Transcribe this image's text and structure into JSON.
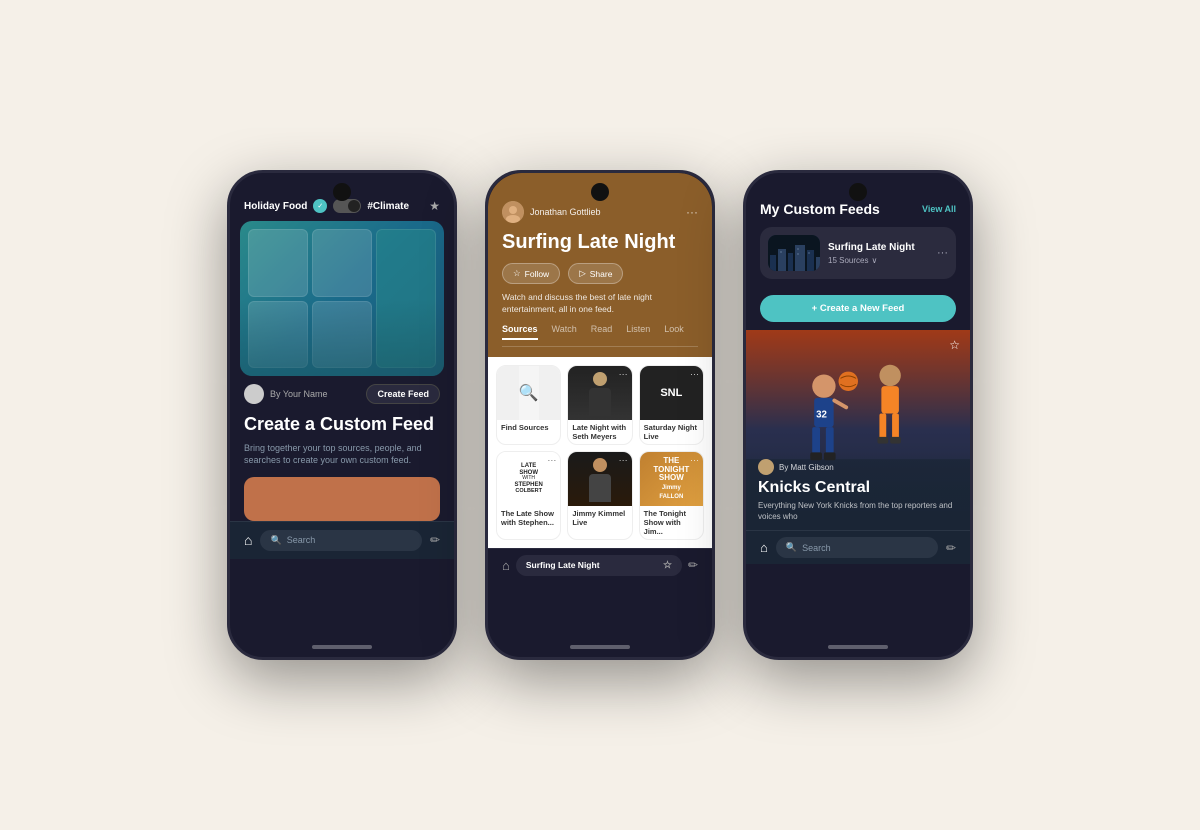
{
  "background": "#f5f0e8",
  "phone1": {
    "top": {
      "holiday_label": "Holiday Food",
      "climate_label": "#Climate",
      "star_icon": "★"
    },
    "title": "Create a Custom Feed",
    "description": "Bring together your top sources, people, and searches to create your own custom feed.",
    "author_label": "By Your Name",
    "create_btn": "Create Feed",
    "bottom_nav": {
      "home_icon": "⌂",
      "search_placeholder": "Search",
      "edit_icon": "✏"
    }
  },
  "phone2": {
    "user": "Jonathan Gottlieb",
    "title": "Surfing Late Night",
    "description": "Watch and discuss the best of late night entertainment, all in one feed.",
    "follow_btn": "Follow",
    "share_btn": "Share",
    "tabs": [
      "Sources",
      "Watch",
      "Read",
      "Listen",
      "Look"
    ],
    "active_tab": "Sources",
    "sources": [
      {
        "name": "Find Sources",
        "type": "find"
      },
      {
        "name": "Late Night with Seth Meyers",
        "type": "seth"
      },
      {
        "name": "Saturday Night Live",
        "type": "snl"
      },
      {
        "name": "The Late Show with Stephen...",
        "type": "lateshow"
      },
      {
        "name": "Jimmy Kimmel Live",
        "type": "kimmel"
      },
      {
        "name": "The Tonight Show with Jim...",
        "type": "fallon"
      }
    ],
    "bottom_nav": {
      "home_icon": "⌂",
      "feed_label": "Surfing Late Night",
      "star_icon": "☆",
      "edit_icon": "✏"
    }
  },
  "phone3": {
    "header": "My Custom Feeds",
    "view_all": "View All",
    "feed_card": {
      "name": "Surfing Late Night",
      "sources_count": "15 Sources",
      "chevron": "∨"
    },
    "create_btn": "+ Create a New Feed",
    "knicks_card": {
      "author": "By Matt Gibson",
      "title": "Knicks Central",
      "description": "Everything New York Knicks from the top reporters and voices who"
    },
    "bottom_nav": {
      "home_icon": "⌂",
      "search_placeholder": "Search",
      "edit_icon": "✏"
    }
  }
}
